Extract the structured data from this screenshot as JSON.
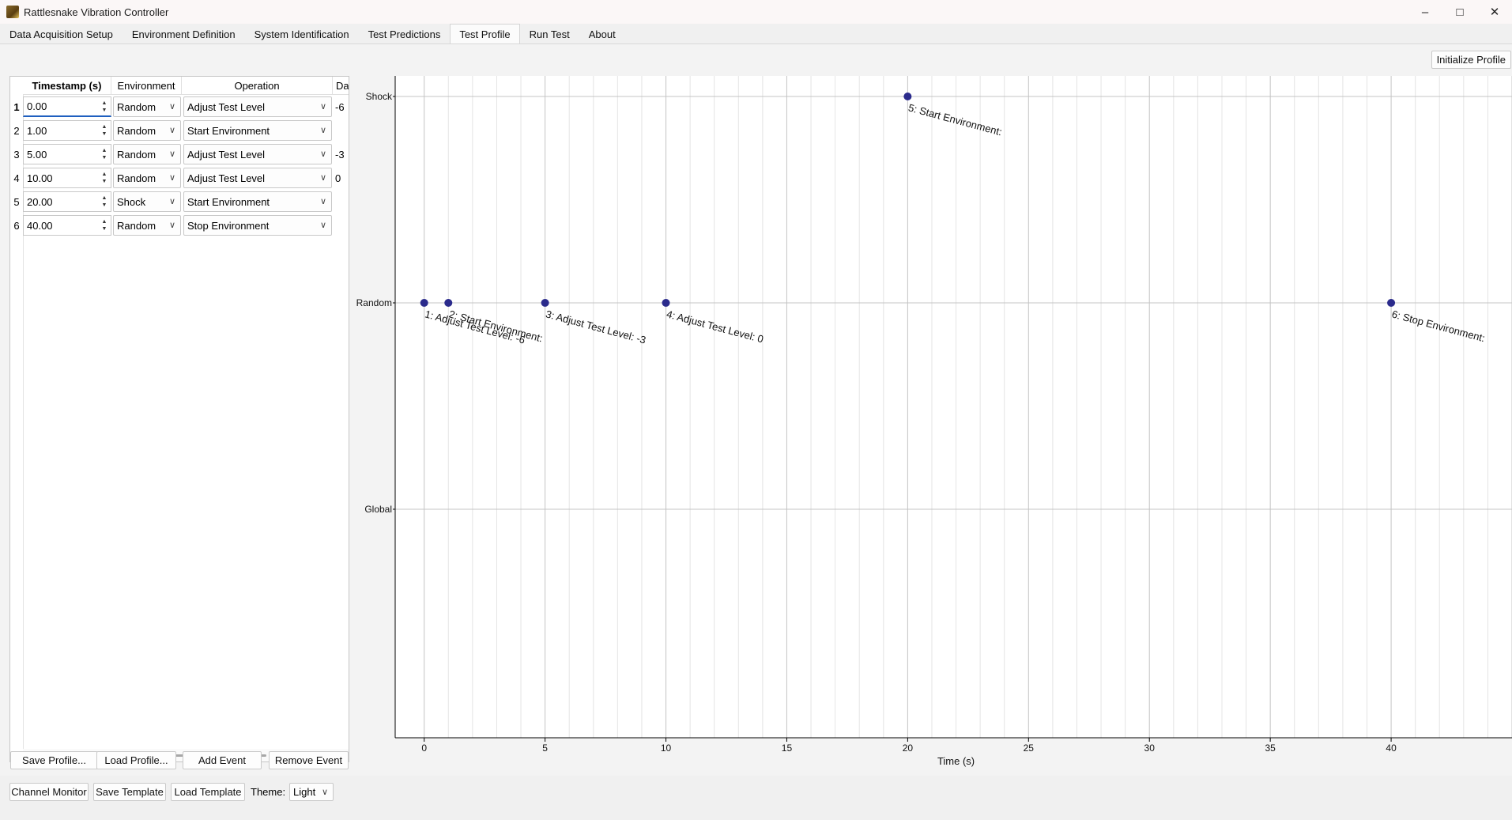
{
  "window": {
    "title": "Rattlesnake Vibration Controller"
  },
  "tabs": [
    {
      "label": "Data Acquisition Setup"
    },
    {
      "label": "Environment Definition"
    },
    {
      "label": "System Identification"
    },
    {
      "label": "Test Predictions"
    },
    {
      "label": "Test Profile",
      "active": true
    },
    {
      "label": "Run Test"
    },
    {
      "label": "About"
    }
  ],
  "toolbar": {
    "initialize_label": "Initialize Profile"
  },
  "table": {
    "columns": [
      "Timestamp (s)",
      "Environment",
      "Operation",
      "Data"
    ],
    "rows": [
      {
        "num": "1",
        "timestamp": "0.00",
        "environment": "Random",
        "operation": "Adjust Test Level",
        "data": "-6"
      },
      {
        "num": "2",
        "timestamp": "1.00",
        "environment": "Random",
        "operation": "Start Environment",
        "data": ""
      },
      {
        "num": "3",
        "timestamp": "5.00",
        "environment": "Random",
        "operation": "Adjust Test Level",
        "data": "-3"
      },
      {
        "num": "4",
        "timestamp": "10.00",
        "environment": "Random",
        "operation": "Adjust Test Level",
        "data": "0"
      },
      {
        "num": "5",
        "timestamp": "20.00",
        "environment": "Shock",
        "operation": "Start Environment",
        "data": ""
      },
      {
        "num": "6",
        "timestamp": "40.00",
        "environment": "Random",
        "operation": "Stop Environment",
        "data": ""
      }
    ]
  },
  "profile_buttons": {
    "save": "Save Profile...",
    "load": "Load Profile...",
    "add": "Add Event",
    "remove": "Remove Event"
  },
  "bottom": {
    "channel_monitor": "Channel Monitor",
    "save_template": "Save Template",
    "load_template": "Load Template",
    "theme_label": "Theme:",
    "theme_value": "Light"
  },
  "chart_data": {
    "type": "scatter",
    "xlabel": "Time (s)",
    "ylabel": "",
    "xlim": [
      -1.2,
      45
    ],
    "x_ticks": [
      0,
      5,
      10,
      15,
      20,
      25,
      30,
      35,
      40
    ],
    "y_categories": [
      "Global",
      "Random",
      "Shock"
    ],
    "grid": true,
    "marker_color": "#2b2b8c",
    "points": [
      {
        "x": 0,
        "y": "Random",
        "label": "1: Adjust Test Level: -6"
      },
      {
        "x": 1,
        "y": "Random",
        "label": "2: Start Environment:"
      },
      {
        "x": 5,
        "y": "Random",
        "label": "3: Adjust Test Level: -3"
      },
      {
        "x": 10,
        "y": "Random",
        "label": "4: Adjust Test Level: 0"
      },
      {
        "x": 20,
        "y": "Shock",
        "label": "5: Start Environment:"
      },
      {
        "x": 40,
        "y": "Random",
        "label": "6: Stop Environment:"
      }
    ]
  }
}
